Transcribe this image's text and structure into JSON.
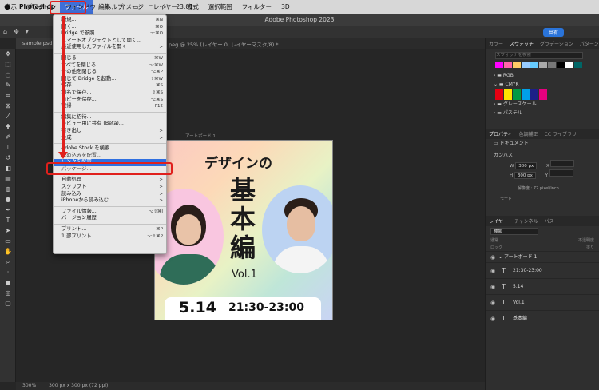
{
  "menubar": {
    "app_name": "Photoshop",
    "items": [
      "ファイル",
      "編集",
      "イメージ",
      "レイヤー",
      "書式",
      "選択範囲",
      "フィルター",
      "3D",
      "表示",
      "プラグイン",
      "ウィンドウ",
      "ヘルプ"
    ],
    "clock": "23:01"
  },
  "window": {
    "title": "Adobe Photoshop 2023",
    "share_label": "共有"
  },
  "tabs": {
    "doc1": "sample.psd",
    "doc2": "peg @ 25% (レイヤー 0, レイヤーマスク/8) *"
  },
  "canvas": {
    "artboard_label": "アートボード 1",
    "title_line1": "デザインの",
    "title_line2": "基本編",
    "vol": "Vol.1",
    "date": "5.14",
    "time": "21:30-23:00"
  },
  "file_menu": {
    "items": [
      {
        "label": "新規...",
        "shortcut": "⌘N"
      },
      {
        "label": "開く...",
        "shortcut": "⌘O"
      },
      {
        "label": "Bridge で参照...",
        "shortcut": "⌥⌘O"
      },
      {
        "label": "スマートオブジェクトとして開く...",
        "shortcut": ""
      },
      {
        "label": "最近使用したファイルを開く",
        "shortcut": ">"
      },
      {
        "label": "閉じる",
        "shortcut": "⌘W"
      },
      {
        "label": "すべてを閉じる",
        "shortcut": "⌥⌘W"
      },
      {
        "label": "その他を閉じる",
        "shortcut": "⌥⌘P"
      },
      {
        "label": "閉じて Bridge を起動...",
        "shortcut": "⇧⌘W"
      },
      {
        "label": "保存",
        "shortcut": "⌘S"
      },
      {
        "label": "別名で保存...",
        "shortcut": "⇧⌘S"
      },
      {
        "label": "コピーを保存...",
        "shortcut": "⌥⌘S"
      },
      {
        "label": "復帰",
        "shortcut": "F12"
      },
      {
        "label": "編集に招待...",
        "shortcut": ""
      },
      {
        "label": "レビュー用に共有 (Beta)...",
        "shortcut": ""
      },
      {
        "label": "書き出し",
        "shortcut": ">"
      },
      {
        "label": "生成",
        "shortcut": ">"
      },
      {
        "label": "Adobe Stock を検索...",
        "shortcut": ""
      },
      {
        "label": "埋め込みを配置...",
        "shortcut": ""
      },
      {
        "label": "リンクを配置...",
        "shortcut": ""
      },
      {
        "label": "パッケージ...",
        "shortcut": ""
      },
      {
        "label": "自動処理",
        "shortcut": ">"
      },
      {
        "label": "スクリプト",
        "shortcut": ">"
      },
      {
        "label": "読み込み",
        "shortcut": ">"
      },
      {
        "label": "iPhoneから読み込む",
        "shortcut": ">"
      },
      {
        "label": "ファイル情報...",
        "shortcut": "⌥⇧⌘I"
      },
      {
        "label": "バージョン履歴",
        "shortcut": ""
      },
      {
        "label": "プリント...",
        "shortcut": "⌘P"
      },
      {
        "label": "1 部プリント",
        "shortcut": "⌥⇧⌘P"
      }
    ]
  },
  "swatches": {
    "tabs": [
      "カラー",
      "スウォッチ",
      "グラデーション",
      "パターン"
    ],
    "search_placeholder": "スウォッチを検索",
    "groups": [
      "RGB",
      "CMYK",
      "グレースケール",
      "パステル"
    ],
    "colors": [
      "#1a1a1a",
      "#ffffff",
      "#e6007e",
      "#ffe100",
      "#009944",
      "#00a0e9",
      "#1d2088",
      "#e60012"
    ]
  },
  "properties": {
    "tabs": [
      "プロパティ",
      "色調補正",
      "CC ライブラリ"
    ],
    "doc_label": "ドキュメント",
    "canvas_label": "カンバス",
    "w_label": "W",
    "w_value": "300 px",
    "h_label": "H",
    "h_value": "300 px",
    "x_label": "X",
    "y_label": "Y",
    "resolution": "解像度 : 72 pixel/inch",
    "mode_label": "モード"
  },
  "layers": {
    "tabs": [
      "レイヤー",
      "チャンネル",
      "パス"
    ],
    "kind": "種類",
    "blend": "通常",
    "opacity_label": "不透明度",
    "lock_label": "ロック",
    "fill_label": "塗り",
    "group_name": "アートボード 1",
    "items": [
      "21:30-23:00",
      "5.14",
      "Vol.1",
      "基本編"
    ]
  },
  "status": {
    "zoom": "300%",
    "size": "300 px x 300 px (72 ppi)"
  }
}
